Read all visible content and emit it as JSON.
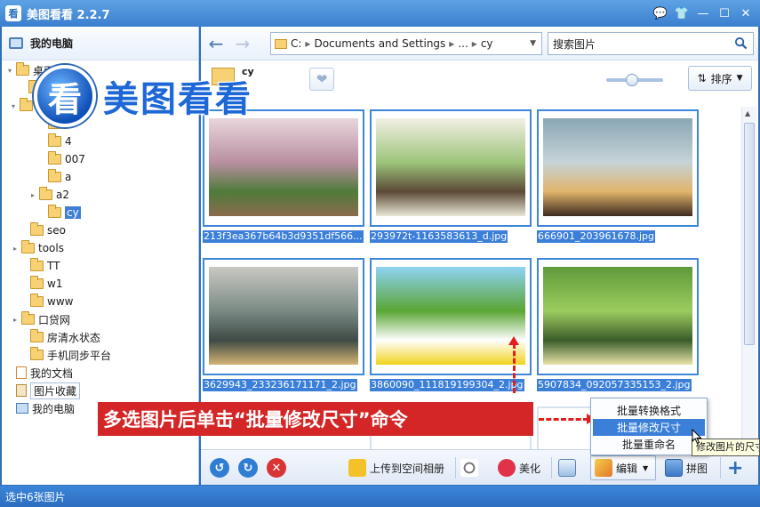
{
  "app": {
    "icon_glyph": "看",
    "title": "美图看看 2.2.7"
  },
  "window_buttons": [
    "💬",
    "👕",
    "—",
    "☐",
    "✕"
  ],
  "sidebar": {
    "title": "我的电脑",
    "tree": [
      {
        "label": "桌面",
        "arrow": "▾",
        "icon": "folder"
      },
      {
        "label": "",
        "arrow": "",
        "icon": "folder"
      },
      {
        "label": "",
        "arrow": "▾",
        "icon": "folder"
      },
      {
        "label": "",
        "arrow": "",
        "icon": "folder"
      },
      {
        "label": "4",
        "arrow": "",
        "icon": "folder"
      },
      {
        "label": "007",
        "arrow": "",
        "icon": "folder"
      },
      {
        "label": "a",
        "arrow": "",
        "icon": "folder"
      },
      {
        "label": "a2",
        "arrow": "▸",
        "icon": "folder"
      },
      {
        "label": "cy",
        "arrow": "",
        "icon": "folder"
      },
      {
        "label": "seo",
        "arrow": "",
        "icon": "folder"
      },
      {
        "label": "tools",
        "arrow": "▸",
        "icon": "folder"
      },
      {
        "label": "TT",
        "arrow": "",
        "icon": "folder"
      },
      {
        "label": "w1",
        "arrow": "",
        "icon": "folder"
      },
      {
        "label": "www",
        "arrow": "",
        "icon": "folder"
      },
      {
        "label": "口贷网",
        "arrow": "▸",
        "icon": "folder"
      },
      {
        "label": "房清水状态",
        "arrow": "",
        "icon": "folder"
      },
      {
        "label": "手机同步平台",
        "arrow": "",
        "icon": "folder"
      },
      {
        "label": "我的文档",
        "arrow": "",
        "icon": "doc"
      },
      {
        "label": "图片收藏",
        "arrow": "",
        "icon": "fav"
      },
      {
        "label": "我的电脑",
        "arrow": "",
        "icon": "computer"
      }
    ]
  },
  "logo": {
    "badge": "看",
    "text": "美图看看"
  },
  "navbar": {
    "path": [
      "C:",
      "Documents and Settings",
      "...",
      "cy"
    ],
    "path_sep": "▸",
    "search_placeholder": "搜索图片"
  },
  "subbar": {
    "folder_name": "cy",
    "sort_label": "排序",
    "zoom_percent": 45
  },
  "thumbnails": [
    {
      "label": "213f3ea367b64b3d9351df566...",
      "palette": [
        "#e8d6dc",
        "#b98fa0",
        "#4f7b3a",
        "#8b6b4d"
      ]
    },
    {
      "label": "293972t-1163583613_d.jpg",
      "palette": [
        "#f2efe4",
        "#9dc47a",
        "#5b4936",
        "#e9e7d6"
      ]
    },
    {
      "label": "666901_203961678.jpg",
      "palette": [
        "#8aa7b5",
        "#c6d3d7",
        "#e0b46a",
        "#3d2b1f"
      ]
    },
    {
      "label": "3629943_233236171171_2.jpg",
      "palette": [
        "#c9c9c3",
        "#7b8a84",
        "#3e4a45",
        "#d3b474"
      ]
    },
    {
      "label": "3860090_111819199304_2.jpg",
      "palette": [
        "#8fd3f4",
        "#5aa534",
        "#ffffff",
        "#f2d31c"
      ]
    },
    {
      "label": "5907834_092057335153_2.jpg",
      "palette": [
        "#5f9a3a",
        "#9ccc5f",
        "#3b5d2a",
        "#e8e2a8"
      ]
    }
  ],
  "toolbar": {
    "upload_label": "上传到空间相册",
    "beautify_label": "美化",
    "edit_label": "编辑",
    "collage_label": "拼图"
  },
  "annotation": {
    "text": "多选图片后单击“批量修改尺寸”命令"
  },
  "context_menu": [
    "批量转换格式",
    "批量修改尺寸",
    "批量重命名"
  ],
  "tooltip": "修改图片的尺寸",
  "status": {
    "text": "选中6张图片"
  }
}
